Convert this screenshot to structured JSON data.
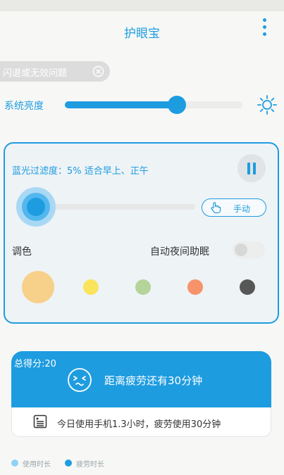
{
  "app": {
    "title": "护眼宝"
  },
  "notice": {
    "text": "闪退或无效问题"
  },
  "brightness": {
    "label": "系统亮度",
    "value_percent": 63
  },
  "filter": {
    "status_text": "蓝光过滤度：5% 适合早上、正午",
    "level_percent": 5,
    "manual_label": "手动",
    "tone_label": "调色",
    "night_mode_label": "自动夜间助眠",
    "night_mode_on": false,
    "paused": false,
    "swatches": [
      {
        "color": "#f7d08a",
        "selected": true
      },
      {
        "color": "#f9e45c",
        "selected": false
      },
      {
        "color": "#b5d49a",
        "selected": false
      },
      {
        "color": "#f6936a",
        "selected": false
      },
      {
        "color": "#575757",
        "selected": false
      }
    ]
  },
  "score": {
    "label": "总得分:20",
    "fatigue_text": "距离疲劳还有30分钟",
    "usage_text": "今日使用手机1.3小时，疲劳使用30分钟"
  },
  "legend": {
    "items": [
      {
        "label": "使用时长",
        "color": "#8fd2f5"
      },
      {
        "label": "疲劳时长",
        "color": "#1e9ce0"
      }
    ]
  },
  "colors": {
    "accent": "#1e9ce0"
  }
}
